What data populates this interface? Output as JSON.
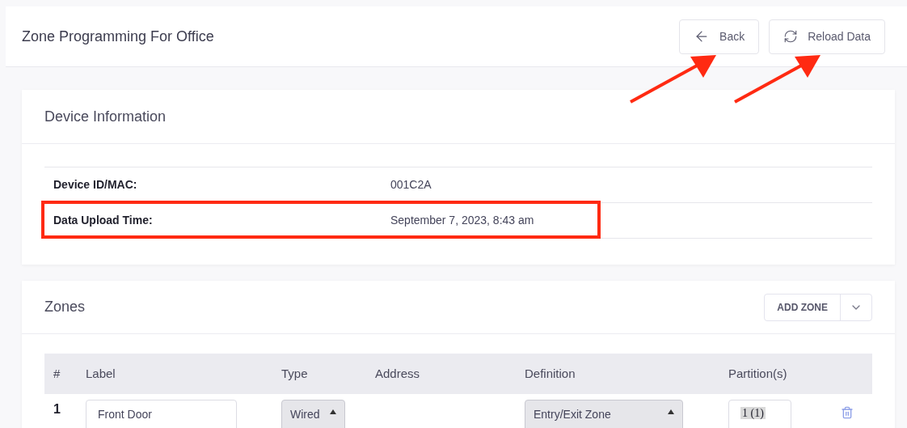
{
  "header": {
    "title": "Zone Programming For Office",
    "buttons": [
      {
        "kind": "back",
        "label": "Back"
      },
      {
        "kind": "reload",
        "label": "Reload Data"
      }
    ]
  },
  "device_information": {
    "title": "Device Information",
    "rows": [
      {
        "label": "Device ID/MAC:",
        "value": "001C2A"
      },
      {
        "label": "Data Upload Time:",
        "value": "September 7, 2023, 8:43 am"
      }
    ]
  },
  "zones": {
    "title": "Zones",
    "add_button": "ADD ZONE",
    "columns": [
      "#",
      "Label",
      "Type",
      "Address",
      "Definition",
      "Partition(s)"
    ],
    "rows": [
      {
        "number": "1",
        "label": "Front Door",
        "type": "Wired",
        "definition": "Entry/Exit Zone",
        "partition": "1 (1)"
      }
    ]
  },
  "annotations": [
    {
      "kind": "arrow"
    },
    {
      "kind": "arrow"
    },
    {
      "kind": "box"
    }
  ]
}
